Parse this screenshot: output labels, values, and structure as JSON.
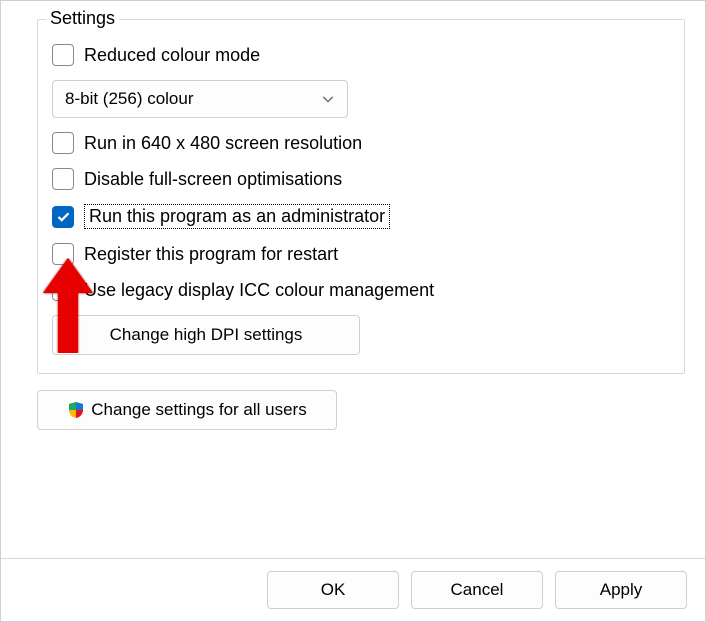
{
  "group": {
    "title": "Settings"
  },
  "options": {
    "reduced_colour": "Reduced colour mode",
    "colour_select": "8-bit (256) colour",
    "run_640": "Run in 640 x 480 screen resolution",
    "disable_fullscreen": "Disable full-screen optimisations",
    "run_admin": "Run this program as an administrator",
    "register_restart": "Register this program for restart",
    "legacy_icc": "Use legacy display ICC colour management",
    "change_dpi": "Change high DPI settings"
  },
  "buttons": {
    "all_users": "Change settings for all users",
    "ok": "OK",
    "cancel": "Cancel",
    "apply": "Apply"
  }
}
